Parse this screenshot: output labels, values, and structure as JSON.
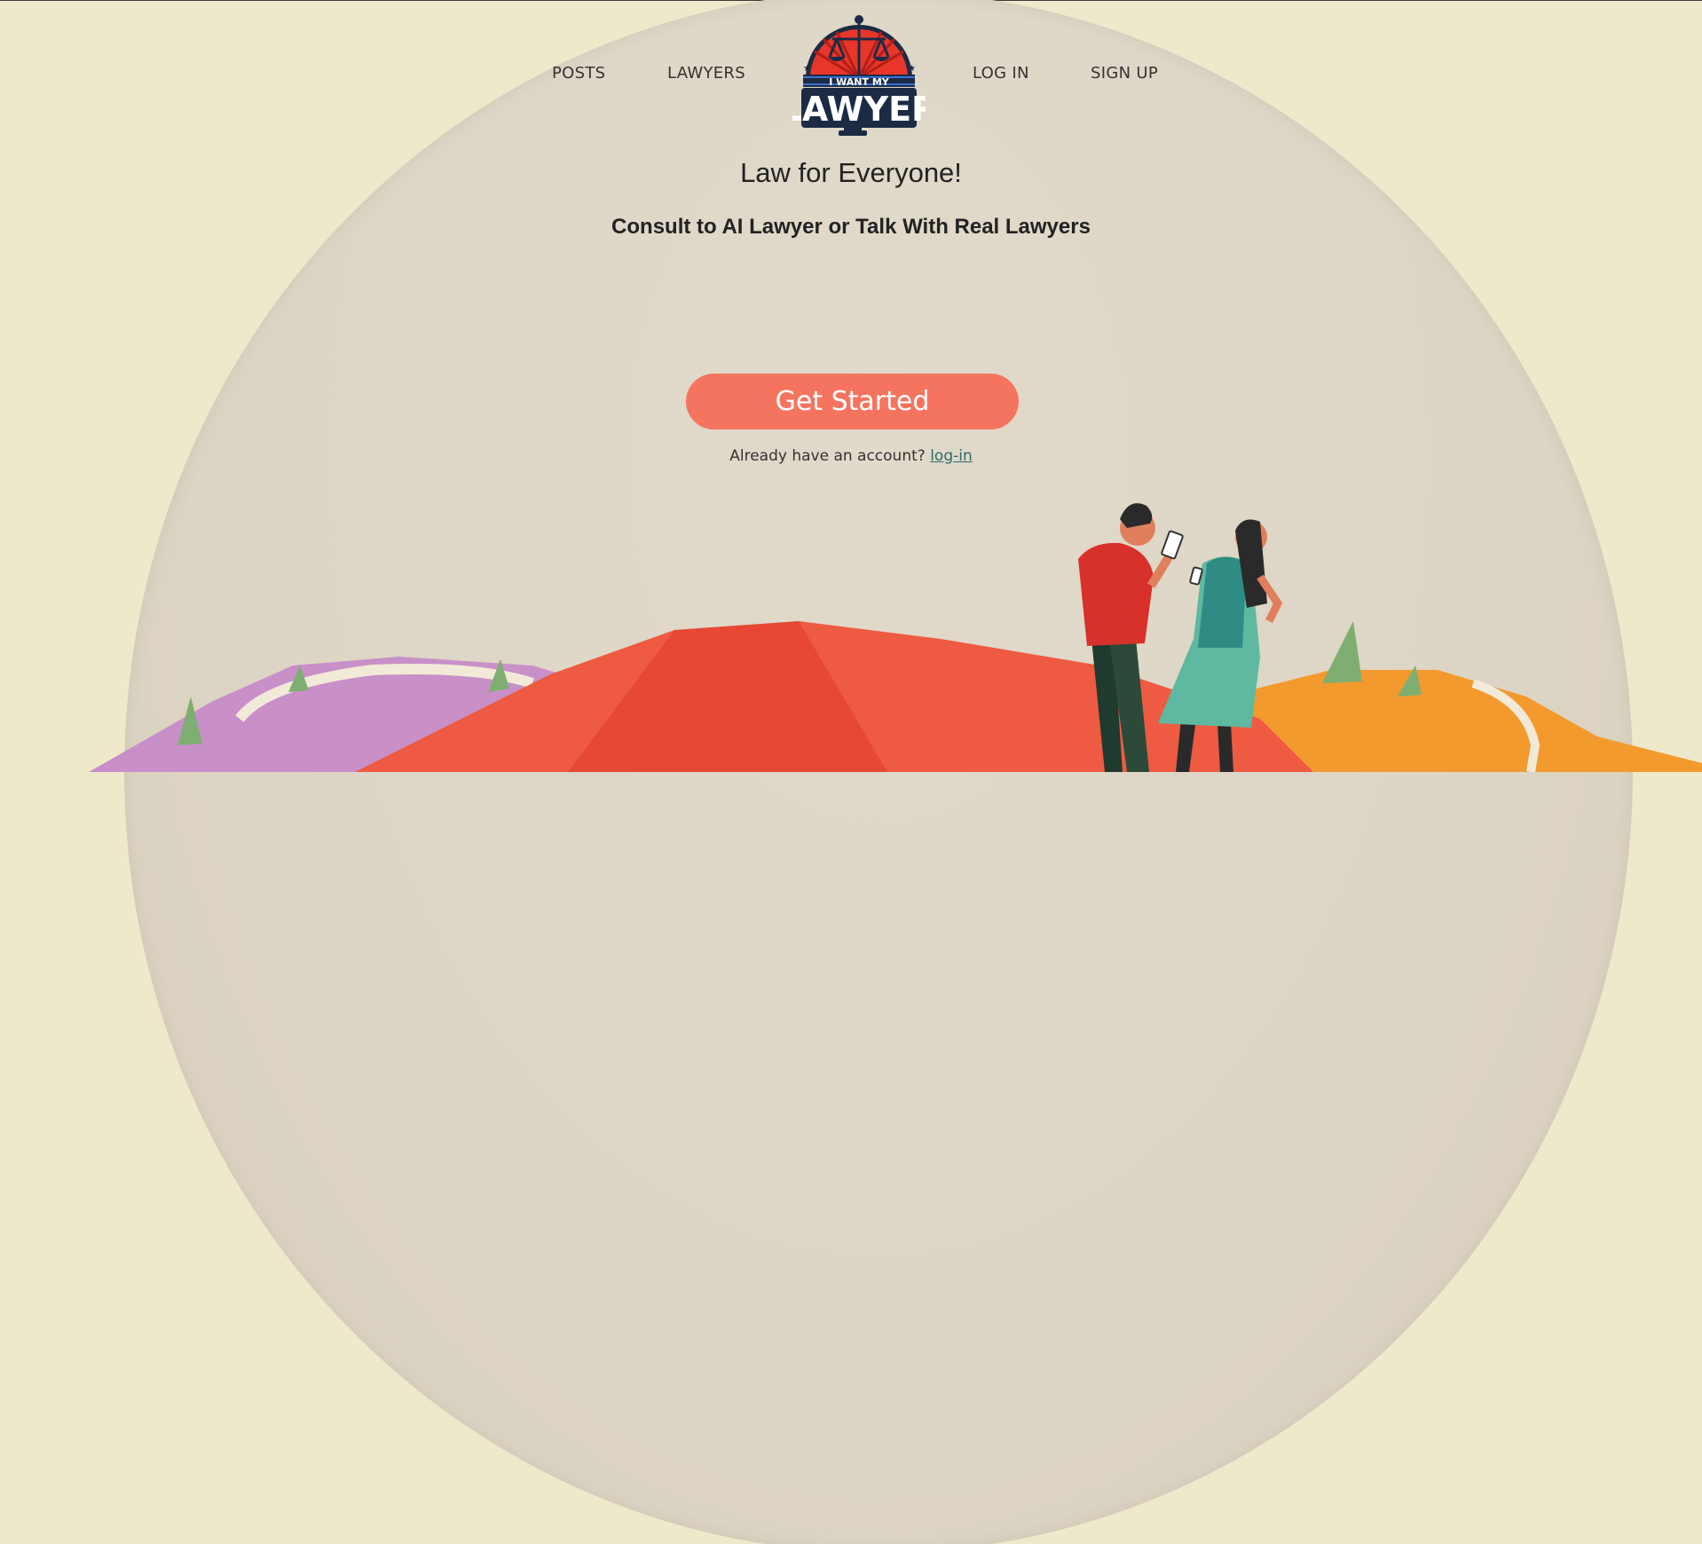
{
  "nav": {
    "posts": "POSTS",
    "lawyers": "LAWYERS",
    "login": "LOG IN",
    "signup": "SIGN UP"
  },
  "logo": {
    "line1": "I WANT MY",
    "line2": "LAWYER",
    "icon": "scales-of-justice-icon"
  },
  "hero": {
    "title": "Law for Everyone!",
    "subtitle": "Consult to AI Lawyer or Talk With Real Lawyers"
  },
  "cta": {
    "label": "Get Started"
  },
  "account": {
    "prompt": "Already have an account?",
    "link": "log-in"
  },
  "colors": {
    "background": "#efe9cb",
    "dome": "#ddd5c5",
    "cta": "#f57460",
    "link": "#2f6b6b"
  }
}
